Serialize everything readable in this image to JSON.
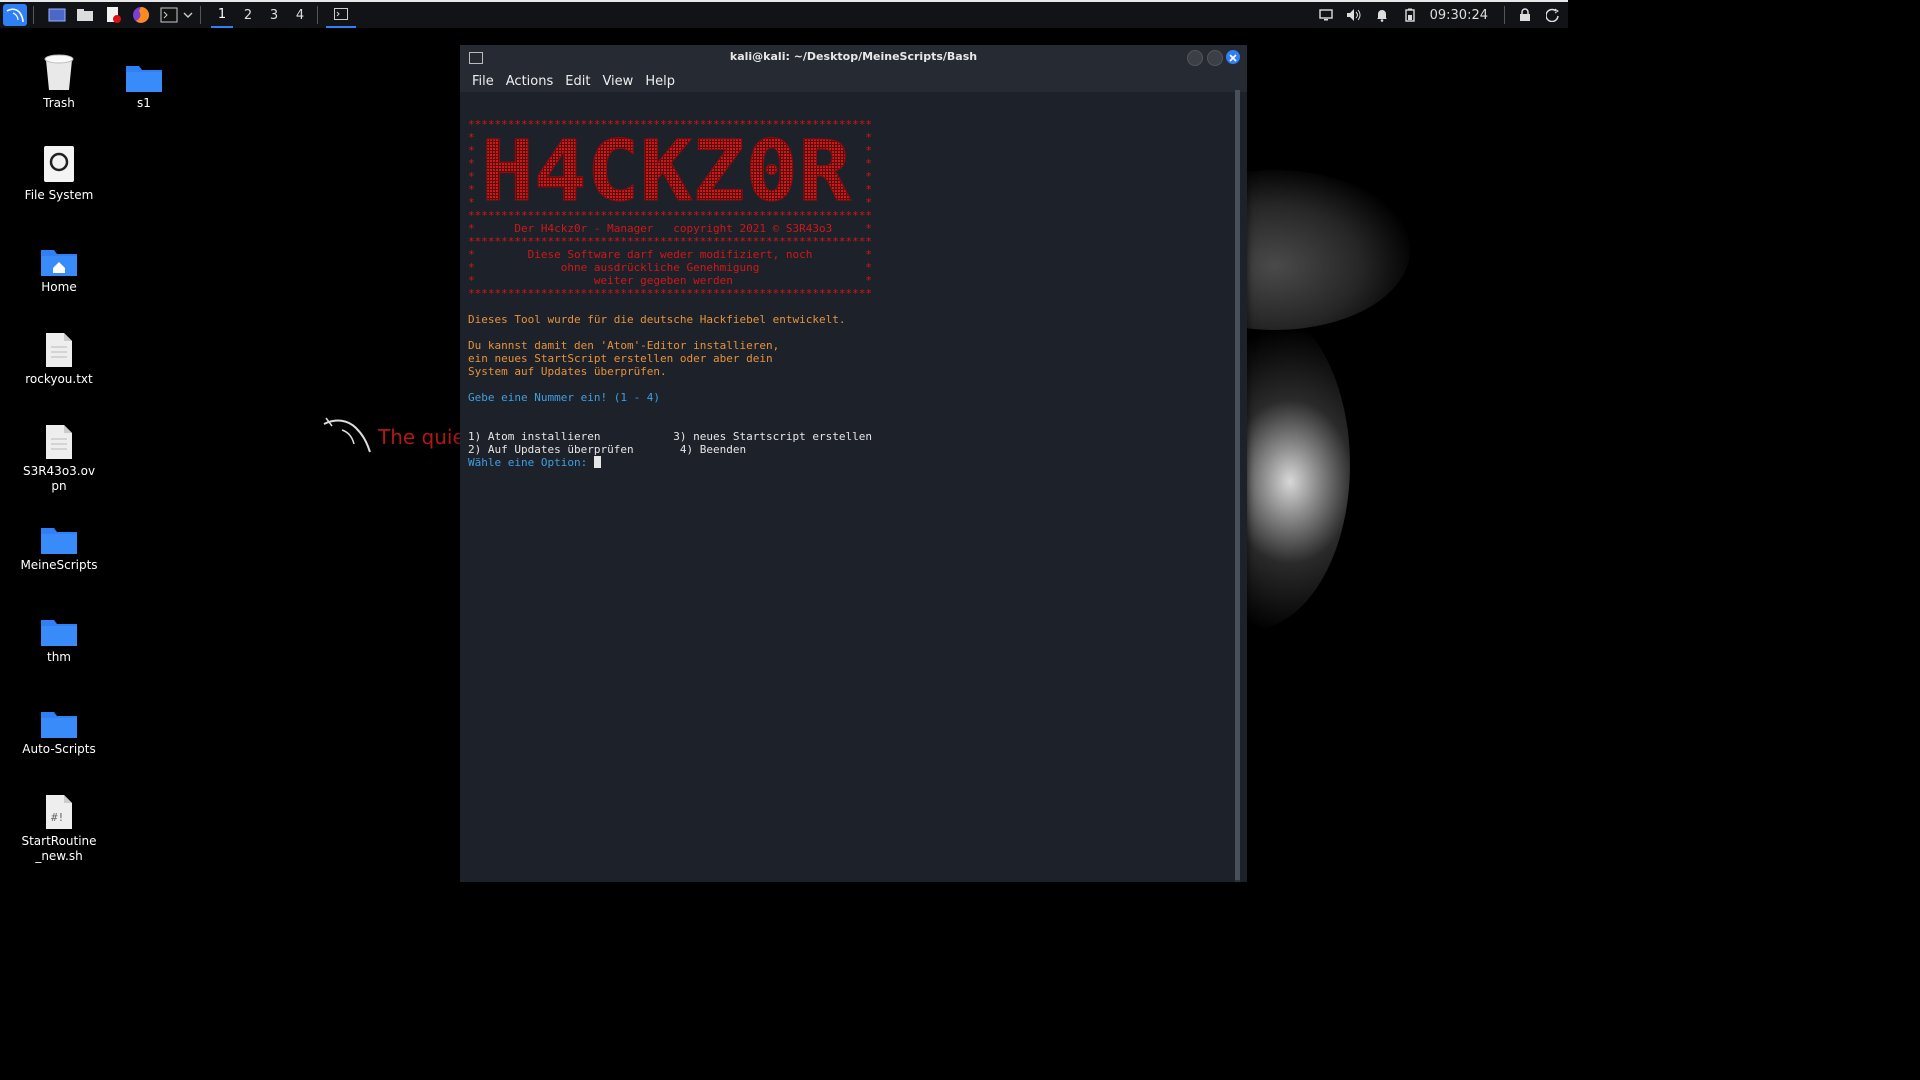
{
  "panel": {
    "workspaces": [
      "1",
      "2",
      "3",
      "4"
    ],
    "clock": "09:30:24"
  },
  "desktop": {
    "icons": [
      {
        "label": "Trash"
      },
      {
        "label": "s1"
      },
      {
        "label": "File System"
      },
      {
        "label": "Home"
      },
      {
        "label": "rockyou.txt"
      },
      {
        "label": "S3R43o3.ovpn"
      },
      {
        "label": "MeineScripts"
      },
      {
        "label": "thm"
      },
      {
        "label": "Auto-Scripts"
      },
      {
        "label": "StartRoutine_new.sh"
      }
    ],
    "wallpaper_slogan": "The quie"
  },
  "window": {
    "title": "kali@kali: ~/Desktop/MeineScripts/Bash",
    "menu": [
      "File",
      "Actions",
      "Edit",
      "View",
      "Help"
    ]
  },
  "terminal": {
    "border_stars": "*************************************************************",
    "banner_text": "H4CKZ0R",
    "header_line": "*      Der H4ckz0r - Manager   copyright 2021 © S3R43o3     *",
    "license_lines": [
      "*        Diese Software darf weder modifiziert, noch        *",
      "*             ohne ausdrückliche Genehmigung                *",
      "*                  weiter gegeben werden                    *"
    ],
    "intro": "Dieses Tool wurde für die deutsche Hackfiebel entwickelt.",
    "description_lines": [
      "Du kannst damit den 'Atom'-Editor installieren,",
      "ein neues StartScript erstellen oder aber dein",
      "System auf Updates überprüfen."
    ],
    "prompt_number": "Gebe eine Nummer ein! (1 - 4)",
    "options_line_1": "1) Atom installieren           3) neues Startscript erstellen",
    "options_line_2": "2) Auf Updates überprüfen       4) Beenden",
    "select_prompt": "Wähle eine Option: "
  },
  "colors": {
    "terminal_bg": "#1d2129",
    "banner_red": "#d11818",
    "text_orange": "#e8923a",
    "prompt_blue": "#3f9fe0",
    "accent_blue": "#2f7ff7"
  }
}
